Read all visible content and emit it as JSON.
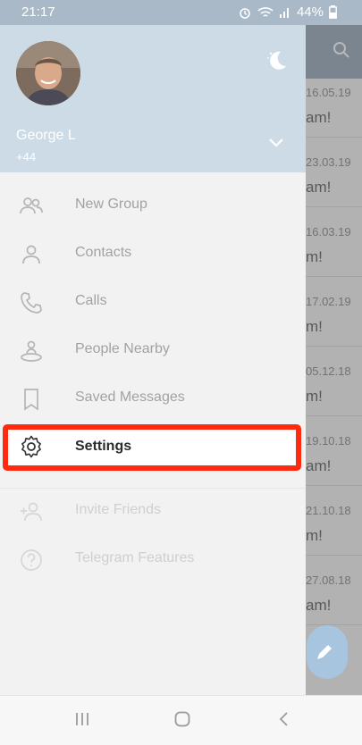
{
  "status_bar": {
    "time": "21:17",
    "battery": "44%"
  },
  "profile": {
    "name": "George L",
    "phone": "+44"
  },
  "menu": [
    {
      "label": "New Group",
      "icon": "users-icon"
    },
    {
      "label": "Contacts",
      "icon": "user-icon"
    },
    {
      "label": "Calls",
      "icon": "phone-icon"
    },
    {
      "label": "People Nearby",
      "icon": "people-nearby-icon"
    },
    {
      "label": "Saved Messages",
      "icon": "bookmark-icon"
    },
    {
      "label": "Settings",
      "icon": "gear-icon"
    },
    {
      "label": "Invite Friends",
      "icon": "add-user-icon"
    },
    {
      "label": "Telegram Features",
      "icon": "help-icon"
    }
  ],
  "chat_list": [
    {
      "date": "16.05.19",
      "preview": "am!"
    },
    {
      "date": "23.03.19",
      "preview": "am!"
    },
    {
      "date": "16.03.19",
      "preview": "m!"
    },
    {
      "date": "17.02.19",
      "preview": "m!"
    },
    {
      "date": "05.12.18",
      "preview": "m!"
    },
    {
      "date": "19.10.18",
      "preview": "am!"
    },
    {
      "date": "21.10.18",
      "preview": "m!"
    },
    {
      "date": "27.08.18",
      "preview": "am!"
    }
  ],
  "colors": {
    "header_bg": "#cddbe7",
    "highlight": "#ff2a0f",
    "fab": "#a7c5de"
  }
}
